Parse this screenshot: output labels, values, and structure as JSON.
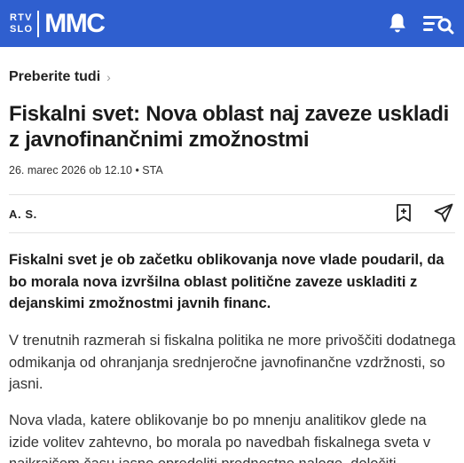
{
  "header": {
    "logo_small_top": "RTV",
    "logo_small_bottom": "SLO",
    "logo_main": "MMC",
    "bar_color": "#2f5fcf",
    "notifications_icon": "bell-icon",
    "menu_icon": "menu-search-icon"
  },
  "breadcrumb": {
    "label": "Preberite tudi",
    "chevron": "›"
  },
  "article": {
    "title": "Fiskalni svet: Nova oblast naj zaveze uskladi z javnofinančnimi zmožnostmi",
    "meta": "26. marec 2026 ob 12.10 • STA",
    "author": "A. S.",
    "bookmark_icon": "bookmark-add-icon",
    "share_icon": "share-icon",
    "lead": "Fiskalni svet je ob začetku oblikovanja nove vlade poudaril, da bo morala nova izvršilna oblast politične zaveze uskladiti z dejanskimi zmožnostmi javnih financ.",
    "paragraph_1": "V trenutnih razmerah si fiskalna politika ne more privoščiti dodatnega odmikanja od ohranjanja srednjeročne javnofinančne vzdržnosti, so jasni.",
    "paragraph_2": "Nova vlada, katere oblikovanje bo po mnenju analitikov glede na izide volitev zahtevno, bo morala po navedbah fiskalnega sveta v najkrajšem času jasno opredeliti prednostne naloge, določiti"
  }
}
